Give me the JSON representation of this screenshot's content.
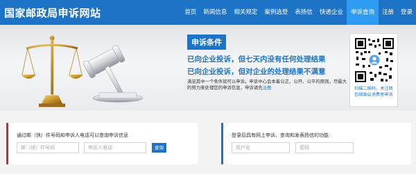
{
  "header": {
    "site_title": "国家邮政局申诉网站",
    "nav": [
      {
        "label": "首页",
        "active": false
      },
      {
        "label": "新闻信息",
        "active": false
      },
      {
        "label": "相关规定",
        "active": false
      },
      {
        "label": "案例选登",
        "active": false
      },
      {
        "label": "表扬信",
        "active": false
      },
      {
        "label": "快递企业",
        "active": false
      },
      {
        "label": "申诉查询",
        "active": true
      },
      {
        "label": "注册",
        "active": false
      },
      {
        "label": "登录",
        "active": false
      }
    ]
  },
  "banner": {
    "title": "申诉条件",
    "line1": "已向企业投诉，但七天内没有任何处理结果",
    "line2": "已向企业投诉，但对企业的处理结果不满意",
    "desc": "满足其中一个条件就可以申诉，申诉中心会本着公正、公开、公平的原则，尽最大的努力来处理您的申诉信息，申诉请先",
    "register_link": "注册",
    "qr_caption": "扫描二维码，关注微信邮政业消费者申诉"
  },
  "query_by_tracking": {
    "title": "通过邮（快）件号码和申诉人电话可以查询申诉信息",
    "tracking_placeholder": "邮（快）件号码",
    "phone_placeholder": "申诉人电话",
    "button_label": "查询"
  },
  "login_panel": {
    "title": "登录后具有网上申诉、查询和发表扬信的功能",
    "username_placeholder": "用户名",
    "password_placeholder": "密码"
  },
  "colors": {
    "brand_blue": "#1d73c5",
    "nav_active": "#2d9cf2",
    "accent_red": "#d9232a"
  }
}
